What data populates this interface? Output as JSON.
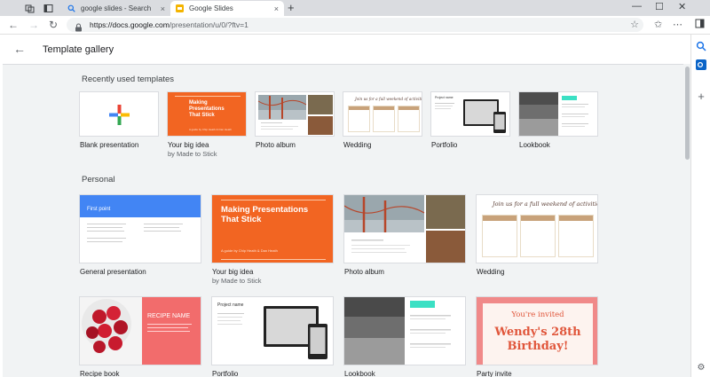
{
  "browser": {
    "tabs": [
      {
        "label": "google slides - Search",
        "close": "×"
      },
      {
        "label": "Google Slides",
        "close": "×"
      }
    ],
    "new_tab": "+",
    "url_host": "https://docs.google.com",
    "url_path": "/presentation/u/0/?ftv=1",
    "window_controls": {
      "minimize": "—",
      "maximize": "☐",
      "close": "✕"
    }
  },
  "page": {
    "title": "Template gallery",
    "sections": {
      "recent": "Recently used templates",
      "personal": "Personal"
    }
  },
  "recent": [
    {
      "name": "Blank presentation",
      "sub": ""
    },
    {
      "name": "Your big idea",
      "sub": "by Made to Stick"
    },
    {
      "name": "Photo album",
      "sub": ""
    },
    {
      "name": "Wedding",
      "sub": ""
    },
    {
      "name": "Portfolio",
      "sub": ""
    },
    {
      "name": "Lookbook",
      "sub": ""
    }
  ],
  "personal": [
    {
      "name": "General presentation",
      "sub": ""
    },
    {
      "name": "Your big idea",
      "sub": "by Made to Stick"
    },
    {
      "name": "Photo album",
      "sub": ""
    },
    {
      "name": "Wedding",
      "sub": ""
    },
    {
      "name": "Recipe book",
      "sub": ""
    },
    {
      "name": "Portfolio",
      "sub": ""
    },
    {
      "name": "Lookbook",
      "sub": ""
    },
    {
      "name": "Party invite",
      "sub": ""
    }
  ],
  "thumbs": {
    "big_idea_title": "Making Presentations That Stick",
    "big_idea_sub": "A guide by Chip Heath & Dan Heath",
    "wedding_head": "Join us for a full weekend of activities!",
    "general_first_point": "First point",
    "recipe_title": "RECIPE NAME",
    "portfolio_title": "Project name",
    "invite_top": "You're invited",
    "invite_title": "Wendy's 28th Birthday!"
  },
  "colors": {
    "accent_orange": "#f26522",
    "slides_yellow": "#f4b400",
    "google_blue": "#4285f4"
  }
}
